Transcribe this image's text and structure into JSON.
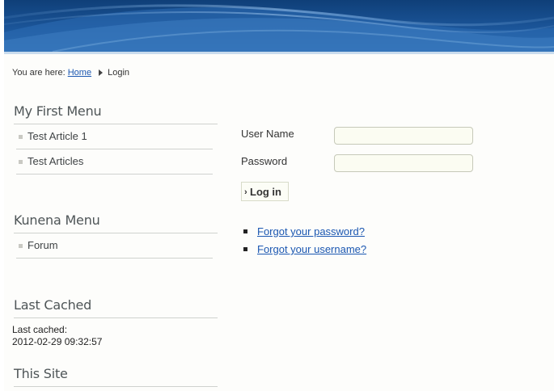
{
  "breadcrumb": {
    "prefix": "You are here:",
    "home": "Home",
    "current": "Login"
  },
  "modules": {
    "first_menu": {
      "title": "My First Menu",
      "items": [
        "Test Article 1",
        "Test Articles"
      ]
    },
    "kunena_menu": {
      "title": "Kunena Menu",
      "items": [
        "Forum"
      ]
    },
    "last_cached": {
      "title": "Last Cached",
      "label": "Last cached:",
      "value": "2012-02-29 09:32:57"
    },
    "this_site": {
      "title": "This Site"
    }
  },
  "login": {
    "username_label": "User Name",
    "username_value": "",
    "password_label": "Password",
    "password_value": "",
    "submit_label": "Log in",
    "links": [
      "Forgot your password?",
      "Forgot your username?"
    ]
  },
  "colors": {
    "link": "#1b57b1",
    "banner": "#1b5599",
    "input_bg": "#fbfcf2"
  }
}
